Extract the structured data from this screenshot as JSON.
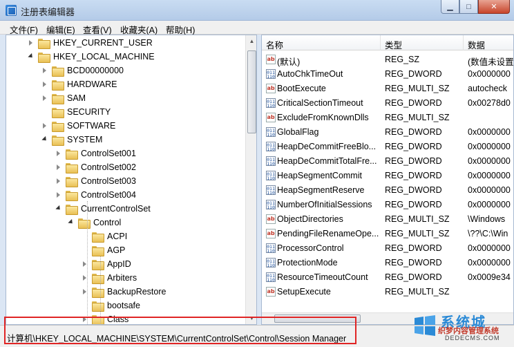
{
  "window": {
    "title": "注册表编辑器",
    "min_glyph": "▁",
    "max_glyph": "□",
    "close_glyph": "✕"
  },
  "menu": [
    "文件(F)",
    "编辑(E)",
    "查看(V)",
    "收藏夹(A)",
    "帮助(H)"
  ],
  "tree": [
    {
      "label": "HKEY_CURRENT_USER",
      "depth": 0,
      "state": "closed"
    },
    {
      "label": "HKEY_LOCAL_MACHINE",
      "depth": 0,
      "state": "open"
    },
    {
      "label": "BCD00000000",
      "depth": 1,
      "state": "closed"
    },
    {
      "label": "HARDWARE",
      "depth": 1,
      "state": "closed"
    },
    {
      "label": "SAM",
      "depth": 1,
      "state": "closed"
    },
    {
      "label": "SECURITY",
      "depth": 1,
      "state": "none"
    },
    {
      "label": "SOFTWARE",
      "depth": 1,
      "state": "closed"
    },
    {
      "label": "SYSTEM",
      "depth": 1,
      "state": "open"
    },
    {
      "label": "ControlSet001",
      "depth": 2,
      "state": "closed"
    },
    {
      "label": "ControlSet002",
      "depth": 2,
      "state": "closed"
    },
    {
      "label": "ControlSet003",
      "depth": 2,
      "state": "closed"
    },
    {
      "label": "ControlSet004",
      "depth": 2,
      "state": "closed"
    },
    {
      "label": "CurrentControlSet",
      "depth": 2,
      "state": "open"
    },
    {
      "label": "Control",
      "depth": 3,
      "state": "open"
    },
    {
      "label": "ACPI",
      "depth": 4,
      "state": "none"
    },
    {
      "label": "AGP",
      "depth": 4,
      "state": "none"
    },
    {
      "label": "AppID",
      "depth": 4,
      "state": "closed"
    },
    {
      "label": "Arbiters",
      "depth": 4,
      "state": "closed"
    },
    {
      "label": "BackupRestore",
      "depth": 4,
      "state": "closed"
    },
    {
      "label": "bootsafe",
      "depth": 4,
      "state": "none"
    },
    {
      "label": "Class",
      "depth": 4,
      "state": "closed"
    }
  ],
  "columns": {
    "name": "名称",
    "type": "类型",
    "data": "数据"
  },
  "values": [
    {
      "name": "(默认)",
      "type": "REG_SZ",
      "data": "(数值未设置)",
      "icon": "ab"
    },
    {
      "name": "AutoChkTimeOut",
      "type": "REG_DWORD",
      "data": "0x0000000",
      "icon": "bin"
    },
    {
      "name": "BootExecute",
      "type": "REG_MULTI_SZ",
      "data": "autocheck",
      "icon": "ab"
    },
    {
      "name": "CriticalSectionTimeout",
      "type": "REG_DWORD",
      "data": "0x00278d0",
      "icon": "bin"
    },
    {
      "name": "ExcludeFromKnownDlls",
      "type": "REG_MULTI_SZ",
      "data": "",
      "icon": "ab"
    },
    {
      "name": "GlobalFlag",
      "type": "REG_DWORD",
      "data": "0x0000000",
      "icon": "bin"
    },
    {
      "name": "HeapDeCommitFreeBlo...",
      "type": "REG_DWORD",
      "data": "0x0000000",
      "icon": "bin"
    },
    {
      "name": "HeapDeCommitTotalFre...",
      "type": "REG_DWORD",
      "data": "0x0000000",
      "icon": "bin"
    },
    {
      "name": "HeapSegmentCommit",
      "type": "REG_DWORD",
      "data": "0x0000000",
      "icon": "bin"
    },
    {
      "name": "HeapSegmentReserve",
      "type": "REG_DWORD",
      "data": "0x0000000",
      "icon": "bin"
    },
    {
      "name": "NumberOfInitialSessions",
      "type": "REG_DWORD",
      "data": "0x0000000",
      "icon": "bin"
    },
    {
      "name": "ObjectDirectories",
      "type": "REG_MULTI_SZ",
      "data": "\\Windows",
      "icon": "ab"
    },
    {
      "name": "PendingFileRenameOpe...",
      "type": "REG_MULTI_SZ",
      "data": "\\??\\C:\\Win",
      "icon": "ab"
    },
    {
      "name": "ProcessorControl",
      "type": "REG_DWORD",
      "data": "0x0000000",
      "icon": "bin"
    },
    {
      "name": "ProtectionMode",
      "type": "REG_DWORD",
      "data": "0x0000000",
      "icon": "bin"
    },
    {
      "name": "ResourceTimeoutCount",
      "type": "REG_DWORD",
      "data": "0x0009e34",
      "icon": "bin"
    },
    {
      "name": "SetupExecute",
      "type": "REG_MULTI_SZ",
      "data": "",
      "icon": "ab"
    }
  ],
  "icons": {
    "ab": "ab",
    "bin": "011\n110"
  },
  "status": {
    "path": "计算机\\HKEY_LOCAL_MACHINE\\SYSTEM\\CurrentControlSet\\Control\\Session Manager"
  },
  "watermark": {
    "title": "系统城",
    "subtitle": "织梦内容管理系统",
    "url": "DEDECMS.COM"
  },
  "colors": {
    "highlight": "#e02424",
    "title_bg": "#c9dcf2"
  }
}
